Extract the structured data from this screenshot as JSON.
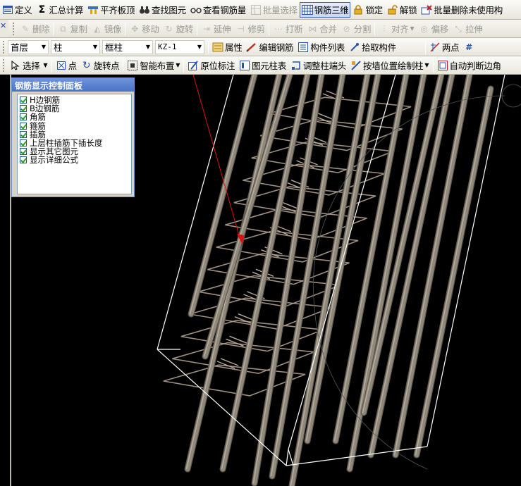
{
  "toolbar1": {
    "define": "定义",
    "summary_calc": "汇总计算",
    "flush_slab": "平齐板顶",
    "find_element": "查找图元",
    "view_rebar_qty": "查看钢筋量",
    "batch_select": "批量选择",
    "rebar_3d": "钢筋三维",
    "lock": "锁定",
    "unlock": "解锁",
    "batch_delete_unused": "批量删除未使用构"
  },
  "toolbar2": {
    "delete": "删除",
    "copy": "复制",
    "mirror": "镜像",
    "move": "移动",
    "rotate": "旋转",
    "extend": "延伸",
    "trim": "修剪",
    "break": "打断",
    "merge": "合并",
    "split": "分割",
    "align": "对齐",
    "offset": "偏移",
    "stretch": "拉伸"
  },
  "toolbar3": {
    "floor_value": "首层",
    "category_value": "柱",
    "type_value": "框柱",
    "component_value": "KZ-1",
    "properties": "属性",
    "edit_rebar": "编辑钢筋",
    "component_list": "构件列表",
    "pick_component": "拾取构件",
    "two_points": "两点"
  },
  "toolbar4": {
    "select": "选择",
    "point": "点",
    "rotate_point": "旋转点",
    "smart_layout": "智能布置",
    "in_place_annotation": "原位标注",
    "element_column_table": "图元柱表",
    "adjust_column_end": "调整柱端头",
    "by_wall_position": "按墙位置绘制柱",
    "auto_judge_edge": "自动判断边角"
  },
  "panel": {
    "title": "钢筋显示控制面板",
    "items": [
      {
        "label": "H边钢筋",
        "checked": true
      },
      {
        "label": "B边钢筋",
        "checked": true
      },
      {
        "label": "角筋",
        "checked": true
      },
      {
        "label": "箍筋",
        "checked": true
      },
      {
        "label": "插筋",
        "checked": true
      },
      {
        "label": "上层柱插筋下插长度",
        "checked": true
      },
      {
        "label": "显示其它图元",
        "checked": true
      },
      {
        "label": "显示详细公式",
        "checked": true
      }
    ]
  },
  "colors": {
    "rebar": "#8f887b",
    "stirrup": "#b8a898",
    "outline": "#ffffff",
    "annotation_arrow": "#dd1111",
    "viewport_bg": "#000000"
  }
}
